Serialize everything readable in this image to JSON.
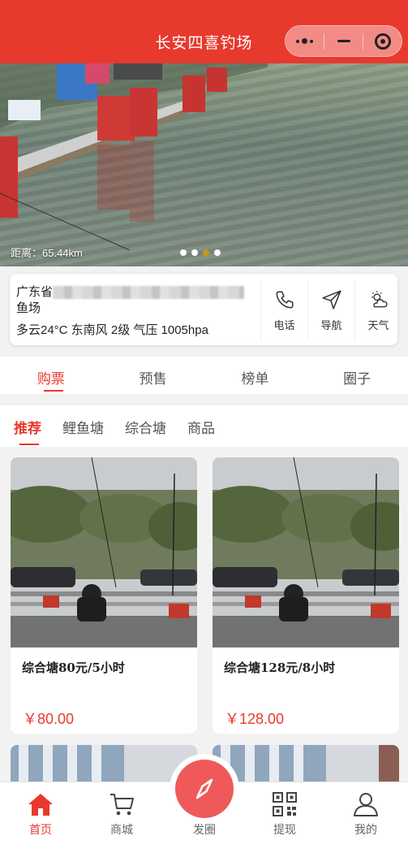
{
  "header": {
    "title": "长安四喜钓场"
  },
  "banner": {
    "distance": "距离：65.44km",
    "slide_count": 4,
    "active_slide": 2
  },
  "info": {
    "address_line1": "广东省",
    "address_line2": "鱼场",
    "weather": "多云24°C  东南风 2级 气压 1005hpa",
    "actions": [
      {
        "label": "电话",
        "icon": "phone-icon"
      },
      {
        "label": "导航",
        "icon": "navigation-icon"
      },
      {
        "label": "天气",
        "icon": "weather-icon"
      }
    ]
  },
  "tabs": [
    "购票",
    "预售",
    "榜单",
    "圈子"
  ],
  "subtabs": [
    "推荐",
    "鲤鱼塘",
    "综合塘",
    "商品"
  ],
  "products": [
    {
      "name": "综合塘80元/5小时",
      "price": "￥80.00"
    },
    {
      "name": "综合塘128元/8小时",
      "price": "￥128.00"
    }
  ],
  "nav": {
    "home": "首页",
    "mall": "商城",
    "post": "发圈",
    "withdraw": "提现",
    "mine": "我的"
  },
  "colors": {
    "accent": "#e8392d",
    "fab": "#f0595a"
  }
}
